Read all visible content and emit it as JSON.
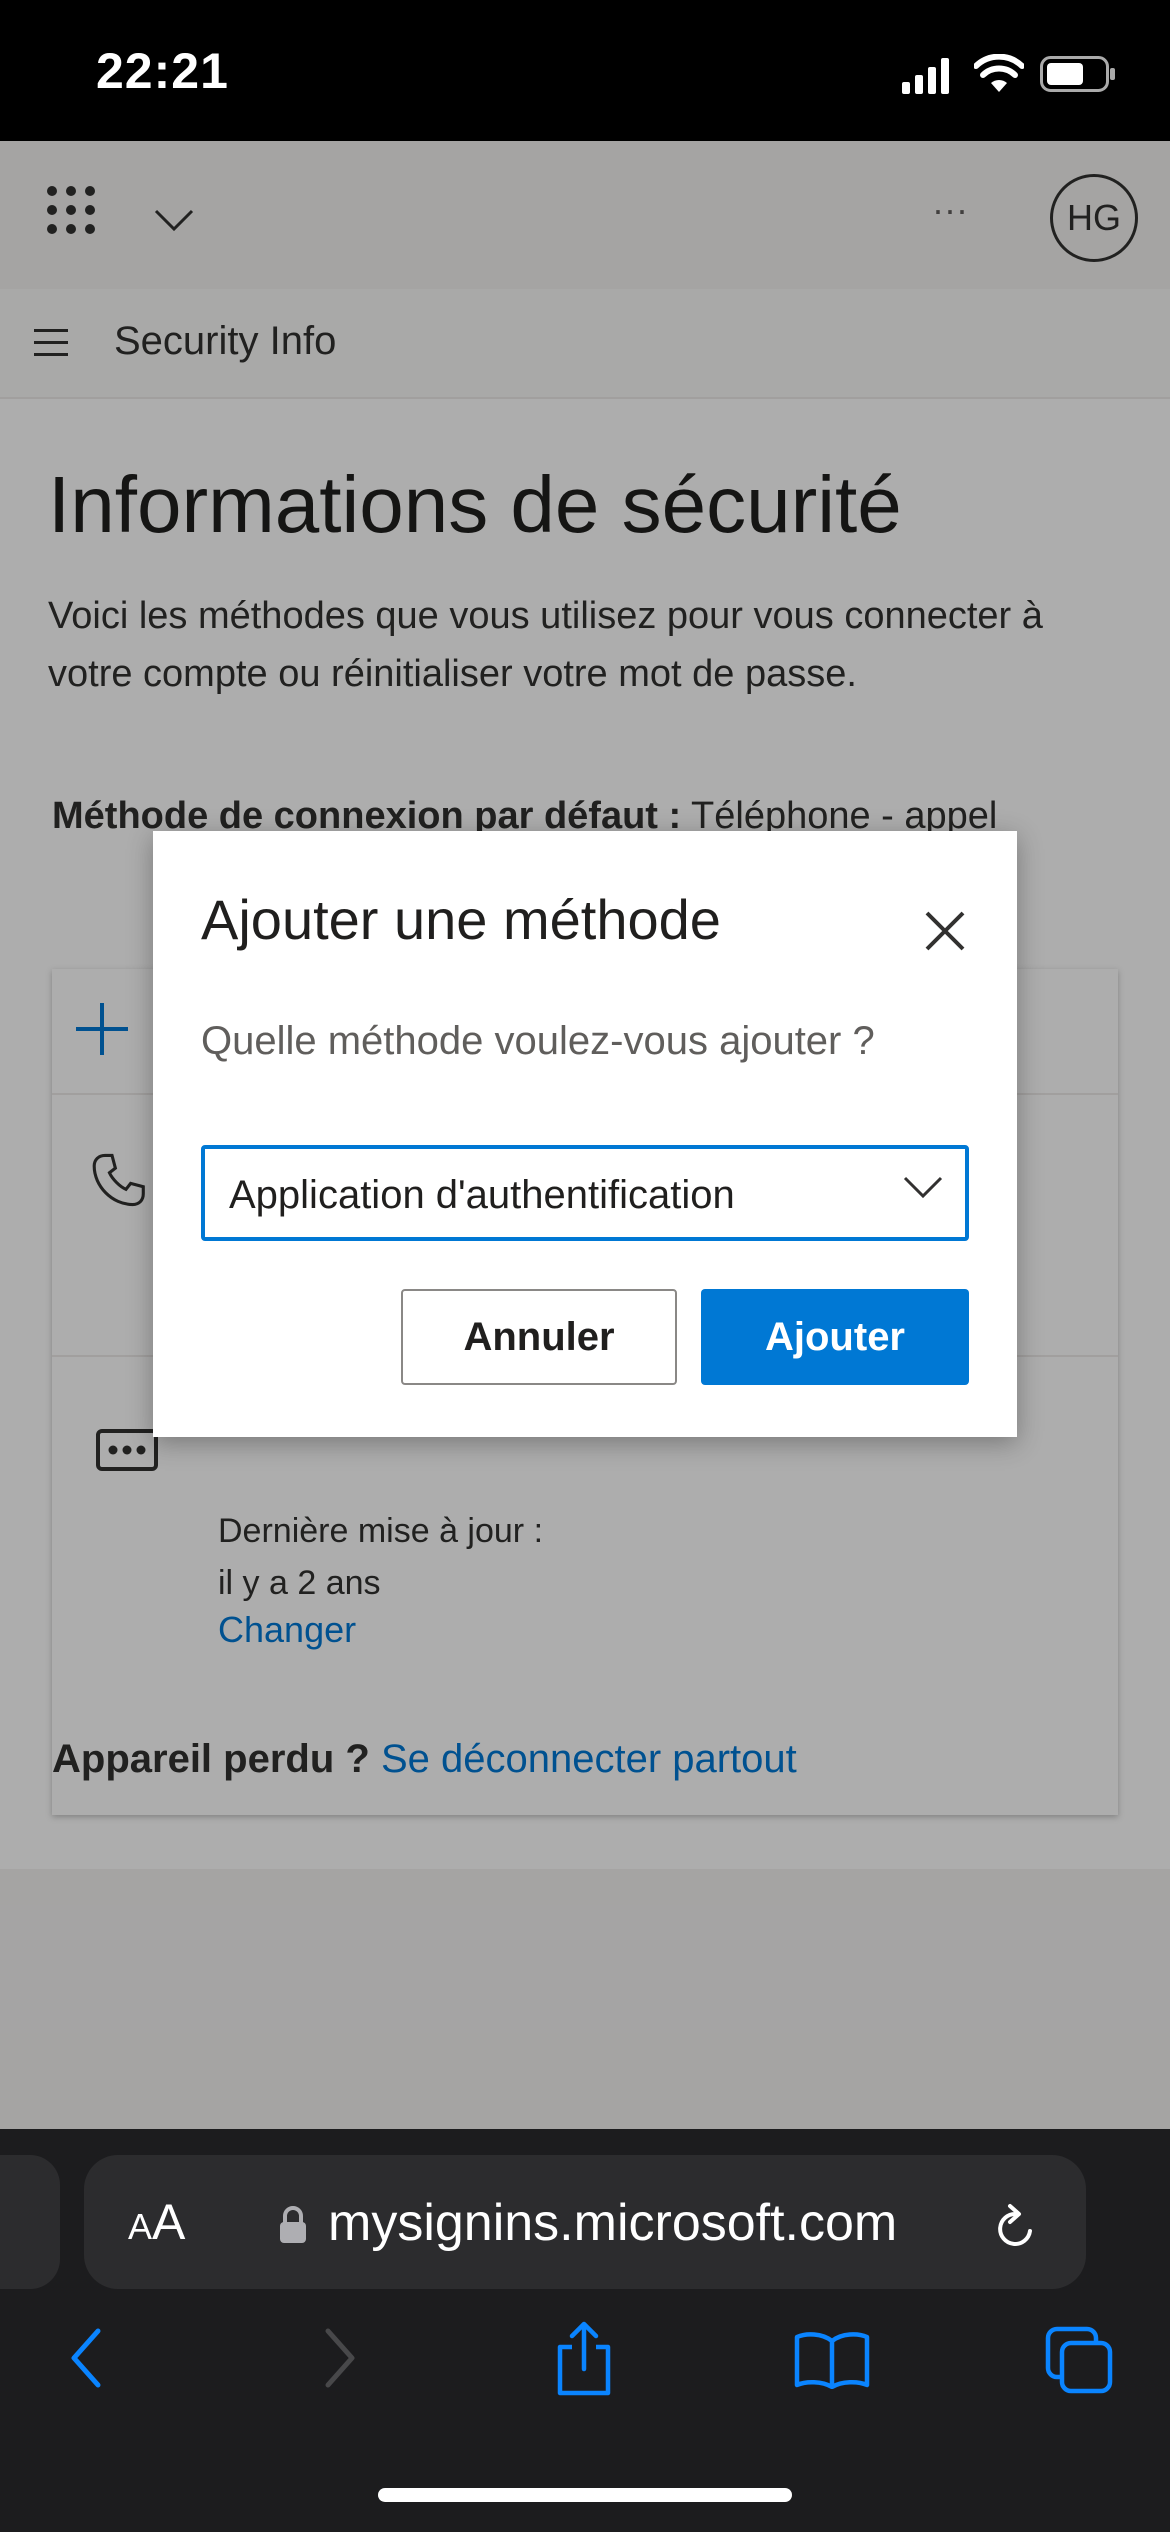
{
  "status_bar": {
    "time": "22:21"
  },
  "header": {
    "avatar_initials": "HG",
    "more_label": "···"
  },
  "subheader": {
    "title": "Security Info"
  },
  "page": {
    "title": "Informations de sécurité",
    "intro": "Voici les méthodes que vous utilisez pour vous connecter à votre compte ou réinitialiser votre mot de passe.",
    "default_method_label": "Méthode de connexion par défaut :",
    "default_method_value": "Téléphone - appel",
    "method_updated_line1": "Dernière mise à jour :",
    "method_updated_line2": "il y a 2 ans",
    "method_change_link": "Changer",
    "lost_device_label": "Appareil perdu ?",
    "signout_everywhere_link": "Se déconnecter partout"
  },
  "modal": {
    "title": "Ajouter une méthode",
    "question": "Quelle méthode voulez-vous ajouter ?",
    "selected_method": "Application d'authentification",
    "cancel_label": "Annuler",
    "add_label": "Ajouter"
  },
  "safari": {
    "aa_label_small": "A",
    "aa_label_large": "A",
    "url": "mysignins.microsoft.com"
  },
  "colors": {
    "accent": "#0078d4",
    "text": "#201f1e",
    "safari_bg": "#1c1c1e"
  }
}
